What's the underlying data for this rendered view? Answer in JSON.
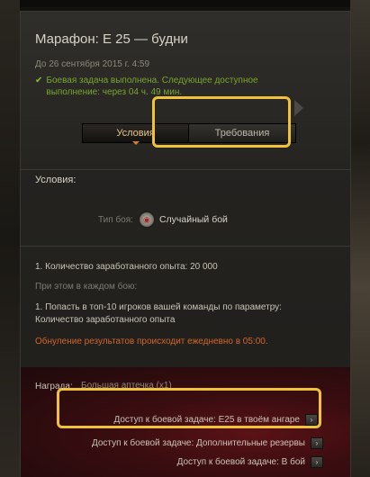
{
  "quest": {
    "title": "Марафон: Е 25 — будни",
    "deadline": "До 26 сентября 2015 г. 4:59",
    "status_text": "Боевая задача выполнена. Следующее доступное выполнение: через 04 ч. 49 мин.",
    "status_icon": "check-icon"
  },
  "tabs": [
    {
      "label": "Условия",
      "active": true
    },
    {
      "label": "Требования",
      "active": false
    }
  ],
  "conditions": {
    "section_title": "Условия:",
    "battle_type_label": "Тип боя:",
    "battle_type_value": "Случайный бой",
    "condition_1": "1. Количество заработанного опыта:  20 000",
    "each_battle_label": "При этом в каждом бою:",
    "condition_2": "1. Попасть в топ-10 игроков вашей команды по параметру: Количество заработанного опыта",
    "reset_note": "Обнуление результатов происходит ежедневно в 05:00."
  },
  "reward": {
    "label": "Награда:",
    "item": "Большая аптечка (x1)",
    "access_1": "Доступ к боевой задаче: Е25 в твоём ангаре",
    "access_2": "Доступ к боевой задаче: Дополнительные резервы",
    "access_3": "Доступ к боевой задаче: В бой"
  },
  "colors": {
    "highlight": "#f0c23b",
    "status_green": "#7aa52e",
    "reset_orange": "#d2662a",
    "tab_active_text": "#e8c78a"
  }
}
